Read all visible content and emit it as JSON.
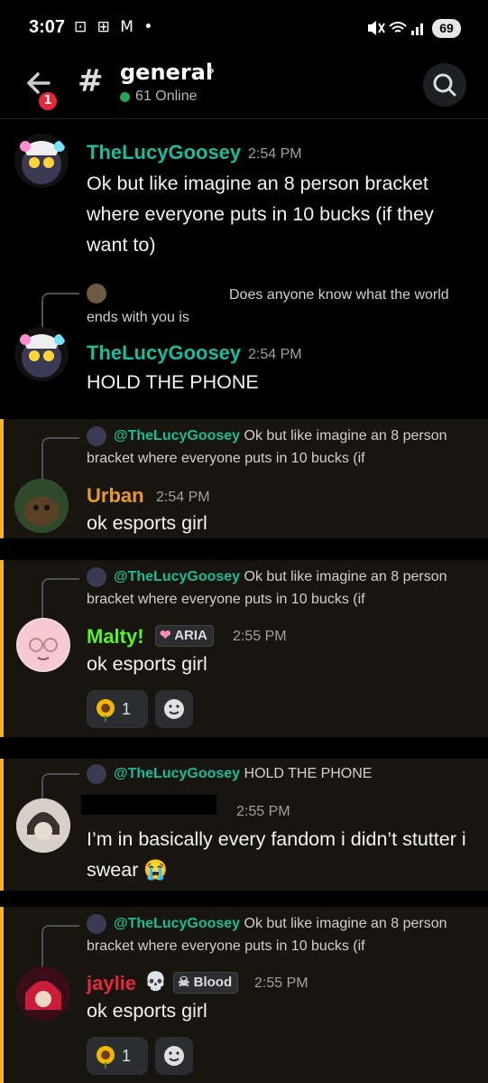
{
  "status_bar": {
    "time": "3:07",
    "left_icons": "⊡ ⊞ M •",
    "battery": "69"
  },
  "header": {
    "unread_count": "1",
    "channel_name": "general",
    "online_count": "61 Online"
  },
  "colors": {
    "teal_user": "#1abc9c",
    "orange_user": "#e59a2b",
    "green_user": "#57f22f",
    "red_user": "#e5283b",
    "mention_bar": "#f0b232"
  },
  "messages": [
    {
      "author": "TheLucyGoosey",
      "time": "2:54 PM",
      "text": "Ok but like imagine an 8 person bracket where everyone puts in 10 bucks (if they want to)"
    },
    {
      "reply_to_text": "Does anyone know what the world ends with you is",
      "author": "TheLucyGoosey",
      "time": "2:54 PM",
      "text": "HOLD THE PHONE"
    },
    {
      "reply_user": "@TheLucyGoosey",
      "reply_to_text": " Ok but like imagine an 8 person bracket where everyone puts in 10 bucks (if",
      "author": "Urban",
      "time": "2:54 PM",
      "text": "ok esports girl"
    },
    {
      "reply_user": "@TheLucyGoosey",
      "reply_to_text": " Ok but like imagine an 8 person bracket where everyone puts in 10 bucks (if",
      "author": "Malty!",
      "tag": "ARIA",
      "time": "2:55 PM",
      "text": "ok esports girl",
      "reaction_count": "1"
    },
    {
      "reply_user": "@TheLucyGoosey",
      "reply_to_text": " HOLD THE PHONE",
      "time": "2:55 PM",
      "text": "I’m in basically every fandom i didn’t stutter i swear 😭"
    },
    {
      "reply_user": "@TheLucyGoosey",
      "reply_to_text": " Ok but like imagine an 8 person bracket where everyone puts in 10 bucks (if",
      "author": "jaylie",
      "author_suffix": "💀",
      "tag": "Blood",
      "time": "2:55 PM",
      "text": "ok esports girl",
      "reaction_count": "1"
    }
  ]
}
